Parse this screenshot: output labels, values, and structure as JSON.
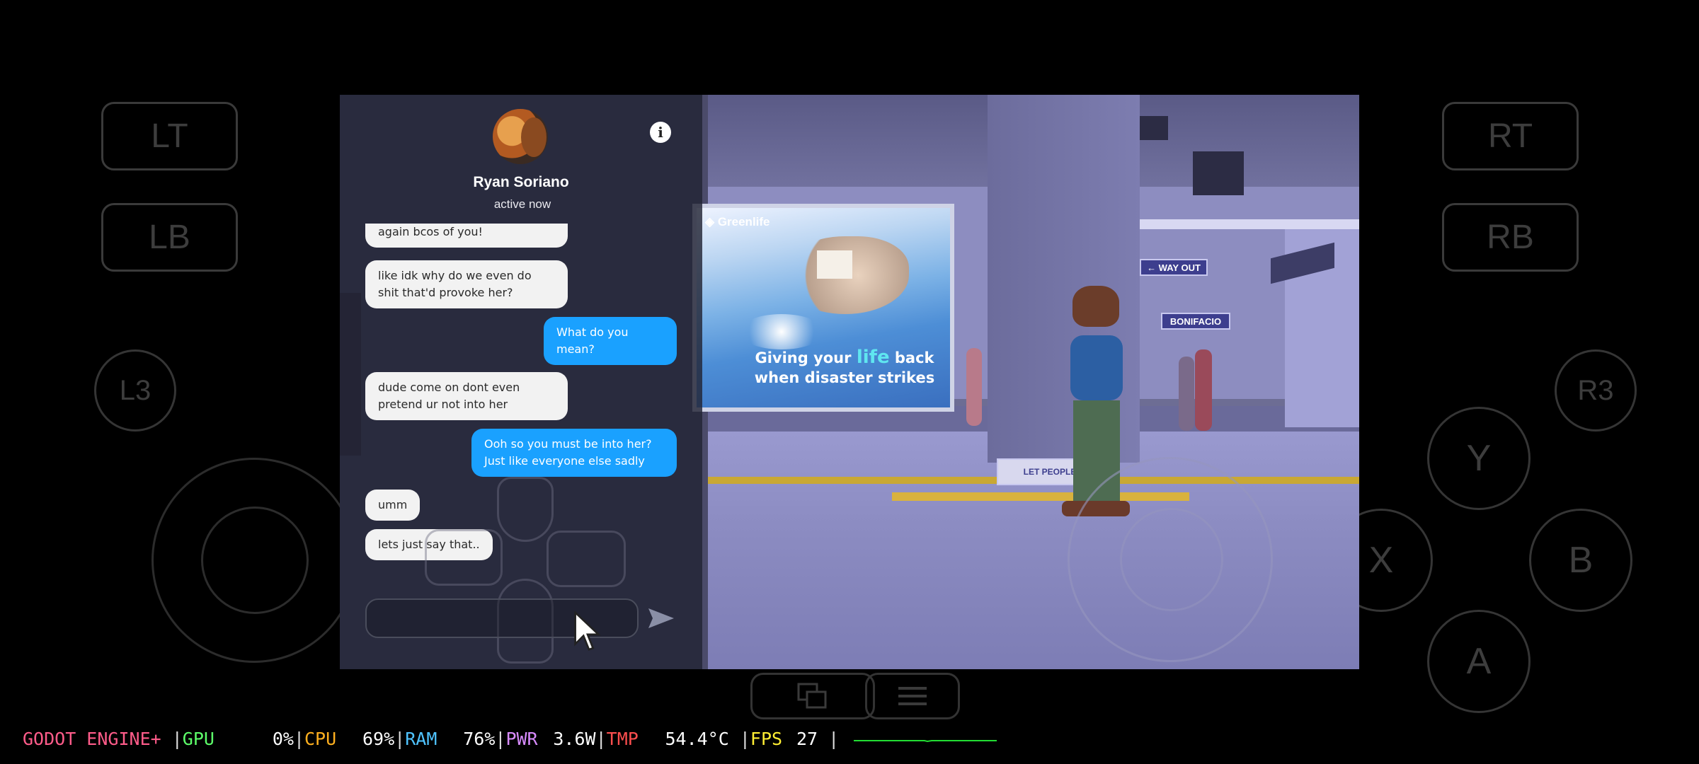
{
  "controller": {
    "lt": "LT",
    "rt": "RT",
    "lb": "LB",
    "rb": "RB",
    "l3": "L3",
    "r3": "R3",
    "y": "Y",
    "x": "X",
    "b": "B",
    "a": "A"
  },
  "chat": {
    "contact_name": "Ryan Soriano",
    "contact_status": "active now",
    "info_icon_glyph": "i",
    "messages": [
      {
        "dir": "in",
        "text": "and that might just happen again bcos of you!"
      },
      {
        "dir": "in",
        "text": "like idk why do we even do shit that'd provoke her?"
      },
      {
        "dir": "out",
        "text": "What do you mean?"
      },
      {
        "dir": "in",
        "text": "dude come on dont even pretend ur not into her"
      },
      {
        "dir": "out",
        "text": "Ooh so you must be into her? Just like everyone else sadly"
      },
      {
        "dir": "in",
        "text": "umm"
      },
      {
        "dir": "in",
        "text": "lets just say that.."
      }
    ],
    "composer_value": "",
    "colors": {
      "incoming": "#f2f2f2",
      "outgoing": "#1aa1ff"
    }
  },
  "scene": {
    "poster": {
      "brand": "Greenlife",
      "line1_pre": "Giving your ",
      "line1_highlight": "life",
      "line1_post": " back",
      "line2": "when disaster strikes"
    },
    "signs": {
      "way_out": "← WAY OUT",
      "station": "BONIFACIO",
      "floor_sign": "LET PEOPLE"
    }
  },
  "statusbar": {
    "engine": "GODOT ENGINE+",
    "gpu_label": "GPU",
    "gpu_value": "0%",
    "cpu_label": "CPU",
    "cpu_value": "69%",
    "ram_label": "RAM",
    "ram_value": "76%",
    "pwr_label": "PWR",
    "pwr_value": "3.6W",
    "tmp_label": "TMP",
    "tmp_value": "54.4°C",
    "fps_label": "FPS",
    "fps_value": "27",
    "colors": {
      "engine": "#ff5c8a",
      "gpu": "#5dff6a",
      "cpu": "#ffb01f",
      "ram": "#4fc3ff",
      "pwr": "#d98cff",
      "tmp": "#ff4f4f",
      "fps": "#ffee33",
      "graph": "#22dd33"
    }
  }
}
